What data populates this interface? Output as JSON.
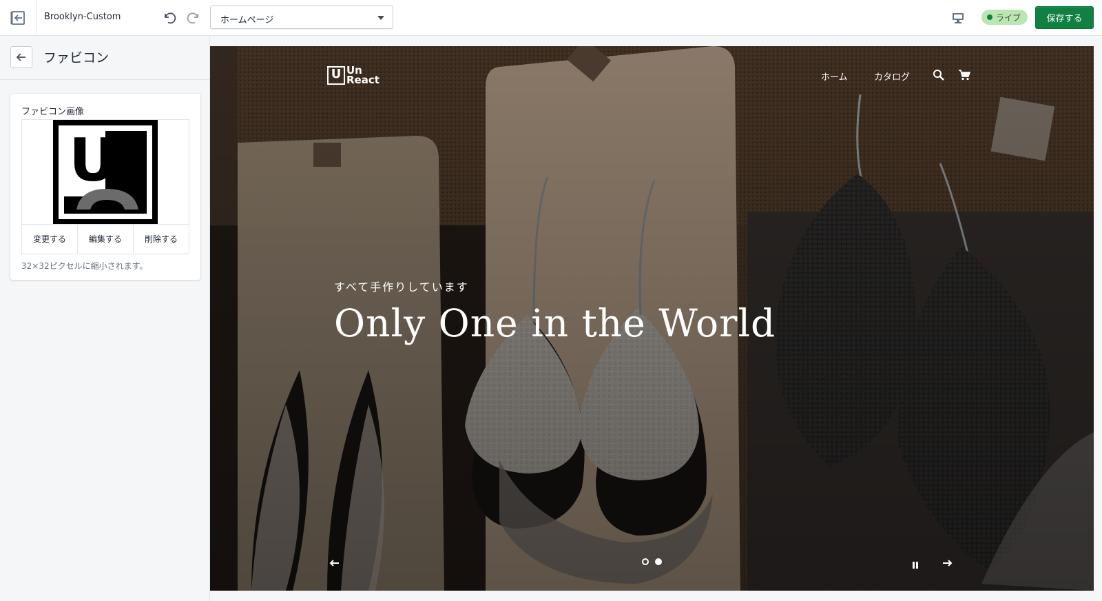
{
  "topbar": {
    "theme_name": "Brooklyn-Custom",
    "page_selector": {
      "value": "ホームページ"
    },
    "live_label": "ライブ",
    "save_label": "保存する"
  },
  "sidebar": {
    "title": "ファビコン",
    "card": {
      "label": "ファビコン画像",
      "image_letter": "U",
      "buttons": [
        "変更する",
        "編集する",
        "削除する"
      ],
      "help_text": "32×32ピクセルに縮小されます。"
    }
  },
  "preview": {
    "logo": {
      "mark": "U",
      "line1": "Un",
      "line2": "React"
    },
    "nav": [
      "ホーム",
      "カタログ"
    ],
    "slide": {
      "subtitle": "すべて手作りしています",
      "headline": "Only One in the World",
      "dots": 2,
      "active_dot": 2
    }
  },
  "colors": {
    "primary_green": "#108043",
    "live_badge_bg": "#bbe5b3"
  }
}
